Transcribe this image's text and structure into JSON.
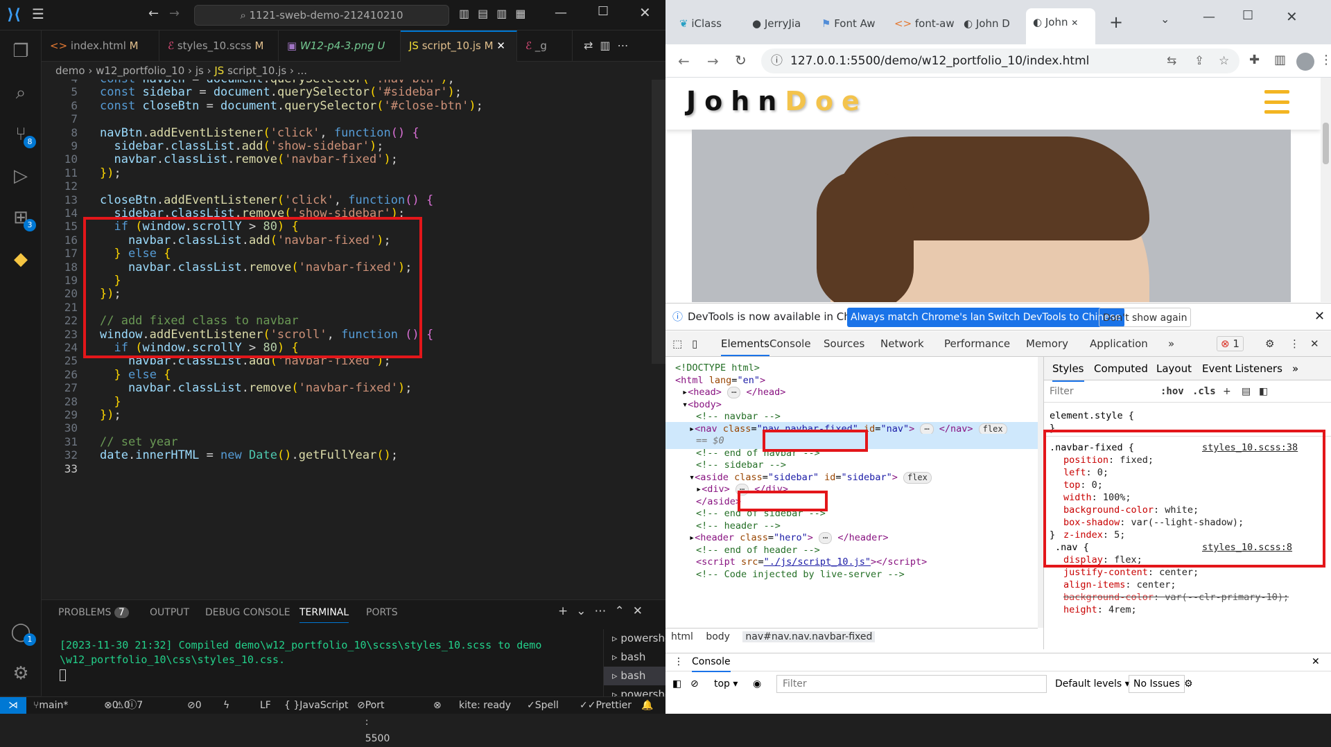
{
  "vscode": {
    "search": "1121-sweb-demo-212410210",
    "activity_badges": {
      "scm": "8",
      "extensions": "3",
      "accounts": "1"
    },
    "tabs": [
      {
        "label": "index.html",
        "status": "M"
      },
      {
        "label": "styles_10.scss",
        "status": "M"
      },
      {
        "label": "W12-p4-3.png",
        "status": "U"
      },
      {
        "label": "script_10.js",
        "status": "M"
      },
      {
        "label": "_g"
      }
    ],
    "breadcrumb": [
      "demo",
      "w12_portfolio_10",
      "js",
      "script_10.js",
      "..."
    ],
    "code": [
      {
        "n": "4",
        "t": "const navBtn = document.querySelector('.nav-btn');"
      },
      {
        "n": "5",
        "t": "const sidebar = document.querySelector('#sidebar');"
      },
      {
        "n": "6",
        "t": "const closeBtn = document.querySelector('#close-btn');"
      },
      {
        "n": "7",
        "t": ""
      },
      {
        "n": "8",
        "t": "navBtn.addEventListener('click', function() {"
      },
      {
        "n": "9",
        "t": "  sidebar.classList.add('show-sidebar');"
      },
      {
        "n": "10",
        "t": "  navbar.classList.remove('navbar-fixed');"
      },
      {
        "n": "11",
        "t": "});"
      },
      {
        "n": "12",
        "t": ""
      },
      {
        "n": "13",
        "t": "closeBtn.addEventListener('click', function() {"
      },
      {
        "n": "14",
        "t": "  sidebar.classList.remove('show-sidebar');"
      },
      {
        "n": "15",
        "t": "  if (window.scrollY > 80) {"
      },
      {
        "n": "16",
        "t": "    navbar.classList.add('navbar-fixed');"
      },
      {
        "n": "17",
        "t": "  } else {"
      },
      {
        "n": "18",
        "t": "    navbar.classList.remove('navbar-fixed');"
      },
      {
        "n": "19",
        "t": "  }"
      },
      {
        "n": "20",
        "t": "});"
      },
      {
        "n": "21",
        "t": ""
      },
      {
        "n": "22",
        "t": "// add fixed class to navbar"
      },
      {
        "n": "23",
        "t": "window.addEventListener('scroll', function () {"
      },
      {
        "n": "24",
        "t": "  if (window.scrollY > 80) {"
      },
      {
        "n": "25",
        "t": "    navbar.classList.add('navbar-fixed');"
      },
      {
        "n": "26",
        "t": "  } else {"
      },
      {
        "n": "27",
        "t": "    navbar.classList.remove('navbar-fixed');"
      },
      {
        "n": "28",
        "t": "  }"
      },
      {
        "n": "29",
        "t": "});"
      },
      {
        "n": "30",
        "t": ""
      },
      {
        "n": "31",
        "t": "// set year"
      },
      {
        "n": "32",
        "t": "date.innerHTML = new Date().getFullYear();"
      },
      {
        "n": "33",
        "t": ""
      }
    ],
    "panel_tabs": {
      "problems": "PROBLEMS",
      "problems_count": "7",
      "output": "OUTPUT",
      "debug": "DEBUG CONSOLE",
      "terminal": "TERMINAL",
      "ports": "PORTS"
    },
    "terminal_output": "[2023-11-30 21:32] Compiled demo\\w12_portfolio_10\\scss\\styles_10.scss to demo\n\\w12_portfolio_10\\css\\styles_10.css.",
    "terminals": [
      "powershell",
      "bash",
      "bash",
      "powershell"
    ],
    "status": {
      "branch": "main*",
      "errors": "0",
      "warnings": "0",
      "info": "0",
      "sync": "7",
      "ports_fwd": "0",
      "eol": "LF",
      "language": "JavaScript",
      "port": "Port : 5500",
      "kite": "kite: ready",
      "spell": "Spell",
      "prettier": "Prettier"
    }
  },
  "chrome": {
    "tabs": [
      "iClass",
      "JerryJia",
      "Font Aw",
      "font-aw",
      "John D",
      "John"
    ],
    "url": "127.0.0.1:5500/demo/w12_portfolio_10/index.html",
    "site": {
      "logo_first": "John",
      "logo_last": "Doe"
    }
  },
  "devtools": {
    "notice": "DevTools is now available in Chinese!",
    "notice_btn1": "Always match Chrome's language",
    "notice_btn2": "Switch DevTools to Chinese",
    "notice_btn3": "Don't show again",
    "tabs": [
      "Elements",
      "Console",
      "Sources",
      "Network",
      "Performance",
      "Memory",
      "Application"
    ],
    "issue_count": "1",
    "breadcrumb": [
      "html",
      "body",
      "nav#nav.nav.navbar-fixed"
    ],
    "styles_tabs": [
      "Styles",
      "Computed",
      "Layout",
      "Event Listeners"
    ],
    "filter_placeholder": "Filter",
    "hov": ":hov",
    "cls": ".cls",
    "element_style": "element.style {",
    "rule_selector": ".navbar-fixed {",
    "rule_source": "styles_10.scss:38",
    "props": [
      {
        "p": "position",
        "v": "fixed;"
      },
      {
        "p": "left",
        "v": "0;"
      },
      {
        "p": "top",
        "v": "0;"
      },
      {
        "p": "width",
        "v": "100%;"
      },
      {
        "p": "background-color",
        "v": "white;"
      },
      {
        "p": "box-shadow",
        "v": "var(--light-shadow);"
      },
      {
        "p": "z-index",
        "v": "5;"
      }
    ],
    "rule2_selector": ".nav {",
    "rule2_source": "styles_10.scss:8",
    "props2": [
      {
        "p": "display",
        "v": "flex;"
      },
      {
        "p": "justify-content",
        "v": "center;"
      },
      {
        "p": "align-items",
        "v": "center;"
      },
      {
        "p": "background-color",
        "v": "var(--clr-primary-10);"
      },
      {
        "p": "height",
        "v": "4rem;"
      }
    ],
    "console_label": "Console",
    "console_context": "top",
    "console_filter": "Filter",
    "default_levels": "Default levels",
    "no_issues": "No Issues"
  }
}
